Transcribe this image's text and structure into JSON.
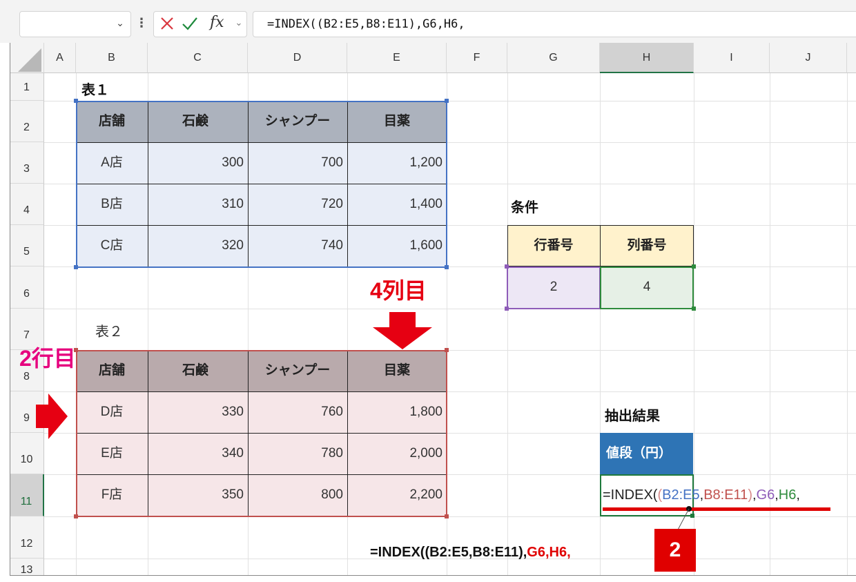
{
  "formula_bar": {
    "name_box": "",
    "fx": "fx",
    "formula": "=INDEX((B2:E5,B8:E11),G6,H6,"
  },
  "columns": [
    "A",
    "B",
    "C",
    "D",
    "E",
    "F",
    "G",
    "H",
    "I",
    "J"
  ],
  "rows": [
    "1",
    "2",
    "3",
    "4",
    "5",
    "6",
    "7",
    "8",
    "9",
    "10",
    "11",
    "12",
    "13"
  ],
  "table1": {
    "title": "表１",
    "headers": [
      "店舗",
      "石鹸",
      "シャンプー",
      "目薬"
    ],
    "rows": [
      [
        "A店",
        "300",
        "700",
        "1,200"
      ],
      [
        "B店",
        "310",
        "720",
        "1,400"
      ],
      [
        "C店",
        "320",
        "740",
        "1,600"
      ]
    ]
  },
  "table2": {
    "title": "表２",
    "headers": [
      "店舗",
      "石鹸",
      "シャンプー",
      "目薬"
    ],
    "rows": [
      [
        "D店",
        "330",
        "760",
        "1,800"
      ],
      [
        "E店",
        "340",
        "780",
        "2,000"
      ],
      [
        "F店",
        "350",
        "800",
        "2,200"
      ]
    ]
  },
  "conditions": {
    "title": "条件",
    "row_header": "行番号",
    "col_header": "列番号",
    "row_value": "2",
    "col_value": "4"
  },
  "result": {
    "title": "抽出結果",
    "header": "値段（円）",
    "formula_parts": {
      "eq": "=INDEX(",
      "paren": "(",
      "r1": "B2:E5",
      "comma1": ",",
      "r2": "B8:E11",
      "close": ")",
      "comma2": ",",
      "g6": "G6",
      "comma3": ",",
      "h6": "H6",
      "comma4": ","
    }
  },
  "annotations": {
    "col4": "4列目",
    "row2": "2行目",
    "badge": "2",
    "caption_black": "=INDEX((B2:E5,B8:E11),",
    "caption_red": "G6,H6,"
  },
  "colors": {
    "table1_border": "#4472c4",
    "table2_border": "#c0504d",
    "accent_red": "#e00000",
    "result_header": "#2e74b5"
  }
}
